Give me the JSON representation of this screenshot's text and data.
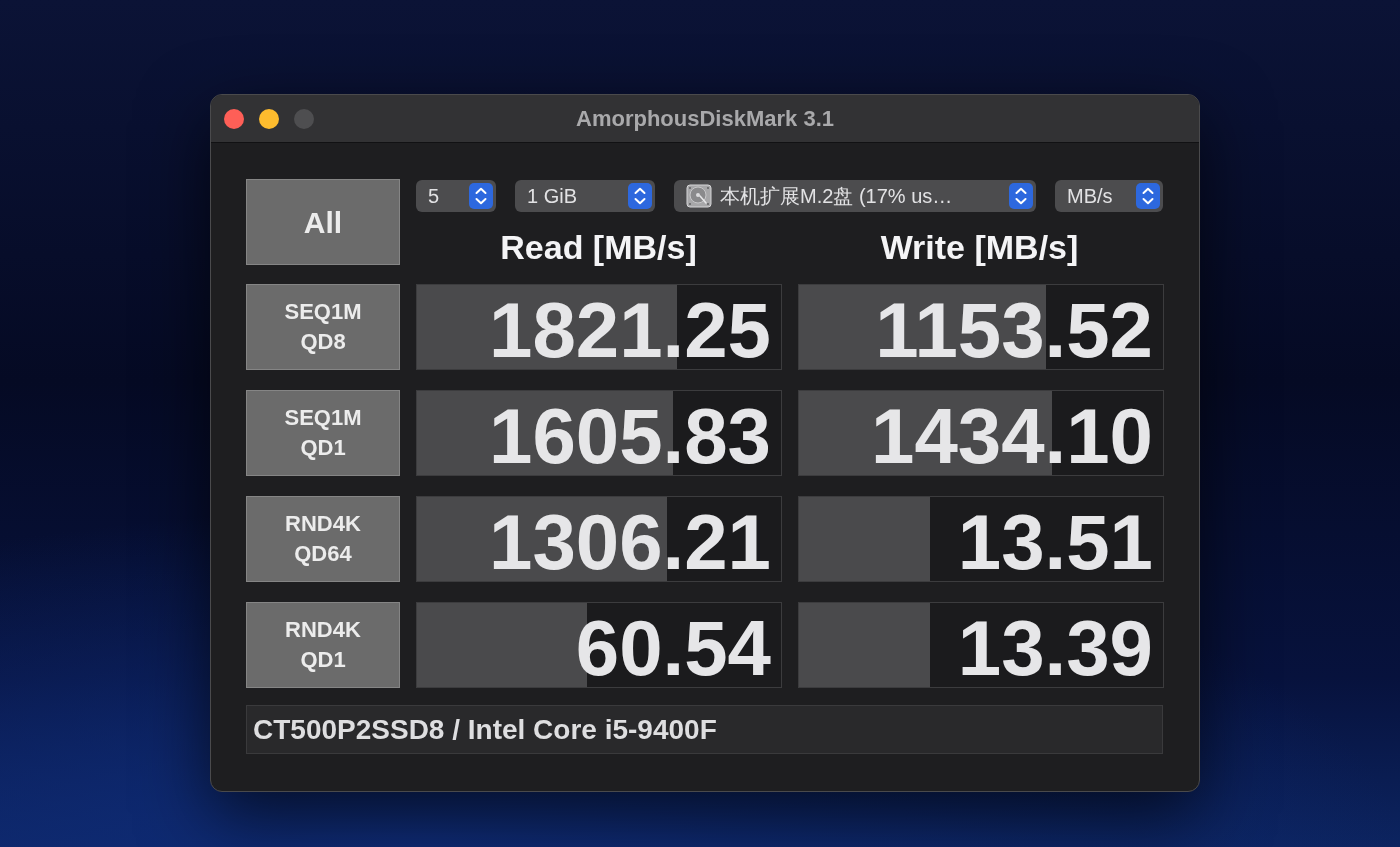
{
  "window": {
    "title": "AmorphousDiskMark 3.1",
    "controls": [
      {
        "kind": "close",
        "disabled": false
      },
      {
        "kind": "minimize",
        "disabled": false
      },
      {
        "kind": "zoom",
        "disabled": true
      }
    ]
  },
  "all_button": {
    "label": "All"
  },
  "settings": [
    {
      "kind": "count",
      "value": "5"
    },
    {
      "kind": "size",
      "value": "1 GiB"
    },
    {
      "kind": "drive",
      "value": "本机扩展M.2盘 (17% us…"
    },
    {
      "kind": "unit",
      "value": "MB/s"
    }
  ],
  "columns": [
    "Read [MB/s]",
    "Write [MB/s]"
  ],
  "tests": [
    {
      "label": "SEQ1M QD8",
      "read": {
        "reading": "1821.25",
        "level": 0.715
      },
      "write": {
        "reading": "1153.52",
        "level": 0.679
      }
    },
    {
      "label": "SEQ1M QD1",
      "read": {
        "reading": "1605.83",
        "level": 0.704
      },
      "write": {
        "reading": "1434.10",
        "level": 0.696
      }
    },
    {
      "label": "RND4K QD64",
      "read": {
        "reading": "1306.21",
        "level": 0.688
      },
      "write": {
        "reading": "13.51",
        "level": 0.359
      }
    },
    {
      "label": "RND4K QD1",
      "read": {
        "reading": "60.54",
        "level": 0.466
      },
      "write": {
        "reading": "13.39",
        "level": 0.359
      }
    }
  ],
  "comment": {
    "value": "CT500P2SSD8 / Intel Core i5-9400F"
  }
}
